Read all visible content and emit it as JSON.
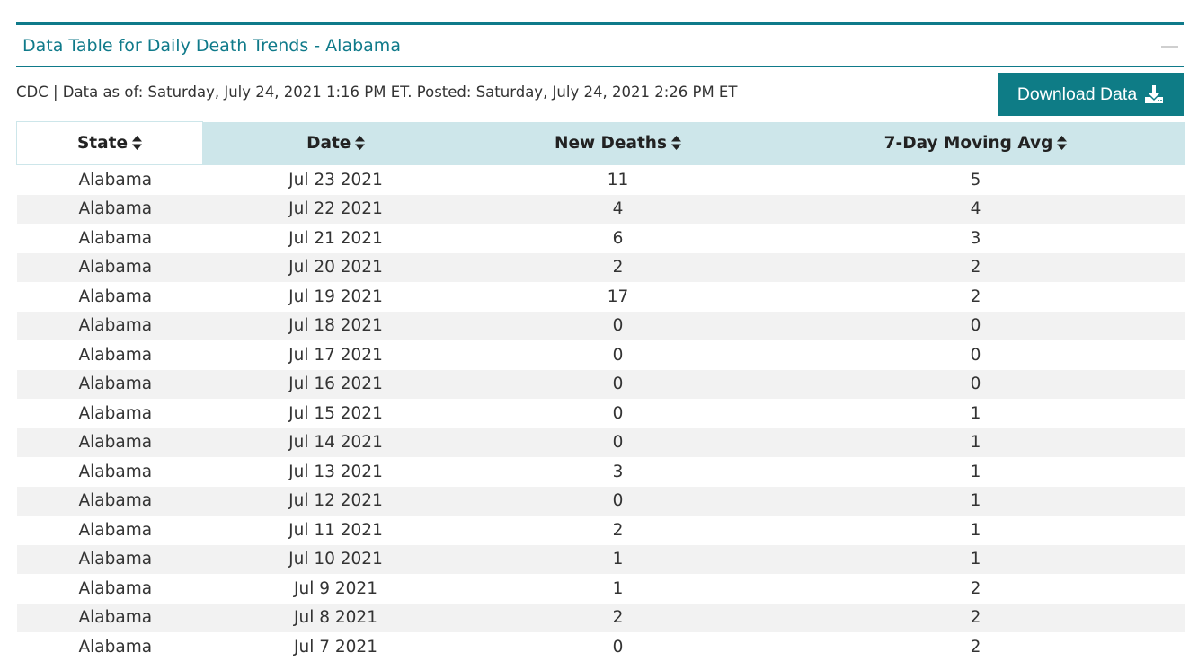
{
  "panel": {
    "title": "Data Table for Daily Death Trends - Alabama"
  },
  "meta": {
    "source_text": "CDC | Data as of: Saturday, July 24, 2021 1:16 PM ET. Posted: Saturday, July 24, 2021 2:26 PM ET"
  },
  "download": {
    "label": "Download Data",
    "icon": "download-icon"
  },
  "table": {
    "columns": [
      "State",
      "Date",
      "New Deaths",
      "7-Day Moving Avg"
    ],
    "rows": [
      [
        "Alabama",
        "Jul 23 2021",
        "11",
        "5"
      ],
      [
        "Alabama",
        "Jul 22 2021",
        "4",
        "4"
      ],
      [
        "Alabama",
        "Jul 21 2021",
        "6",
        "3"
      ],
      [
        "Alabama",
        "Jul 20 2021",
        "2",
        "2"
      ],
      [
        "Alabama",
        "Jul 19 2021",
        "17",
        "2"
      ],
      [
        "Alabama",
        "Jul 18 2021",
        "0",
        "0"
      ],
      [
        "Alabama",
        "Jul 17 2021",
        "0",
        "0"
      ],
      [
        "Alabama",
        "Jul 16 2021",
        "0",
        "0"
      ],
      [
        "Alabama",
        "Jul 15 2021",
        "0",
        "1"
      ],
      [
        "Alabama",
        "Jul 14 2021",
        "0",
        "1"
      ],
      [
        "Alabama",
        "Jul 13 2021",
        "3",
        "1"
      ],
      [
        "Alabama",
        "Jul 12 2021",
        "0",
        "1"
      ],
      [
        "Alabama",
        "Jul 11 2021",
        "2",
        "1"
      ],
      [
        "Alabama",
        "Jul 10 2021",
        "1",
        "1"
      ],
      [
        "Alabama",
        "Jul 9 2021",
        "1",
        "2"
      ],
      [
        "Alabama",
        "Jul 8 2021",
        "2",
        "2"
      ],
      [
        "Alabama",
        "Jul 7 2021",
        "0",
        "2"
      ]
    ]
  },
  "colors": {
    "accent": "#0f7a8a",
    "button": "#0e7c86",
    "header_bg": "#cde6ea",
    "stripe": "#f2f2f2"
  }
}
